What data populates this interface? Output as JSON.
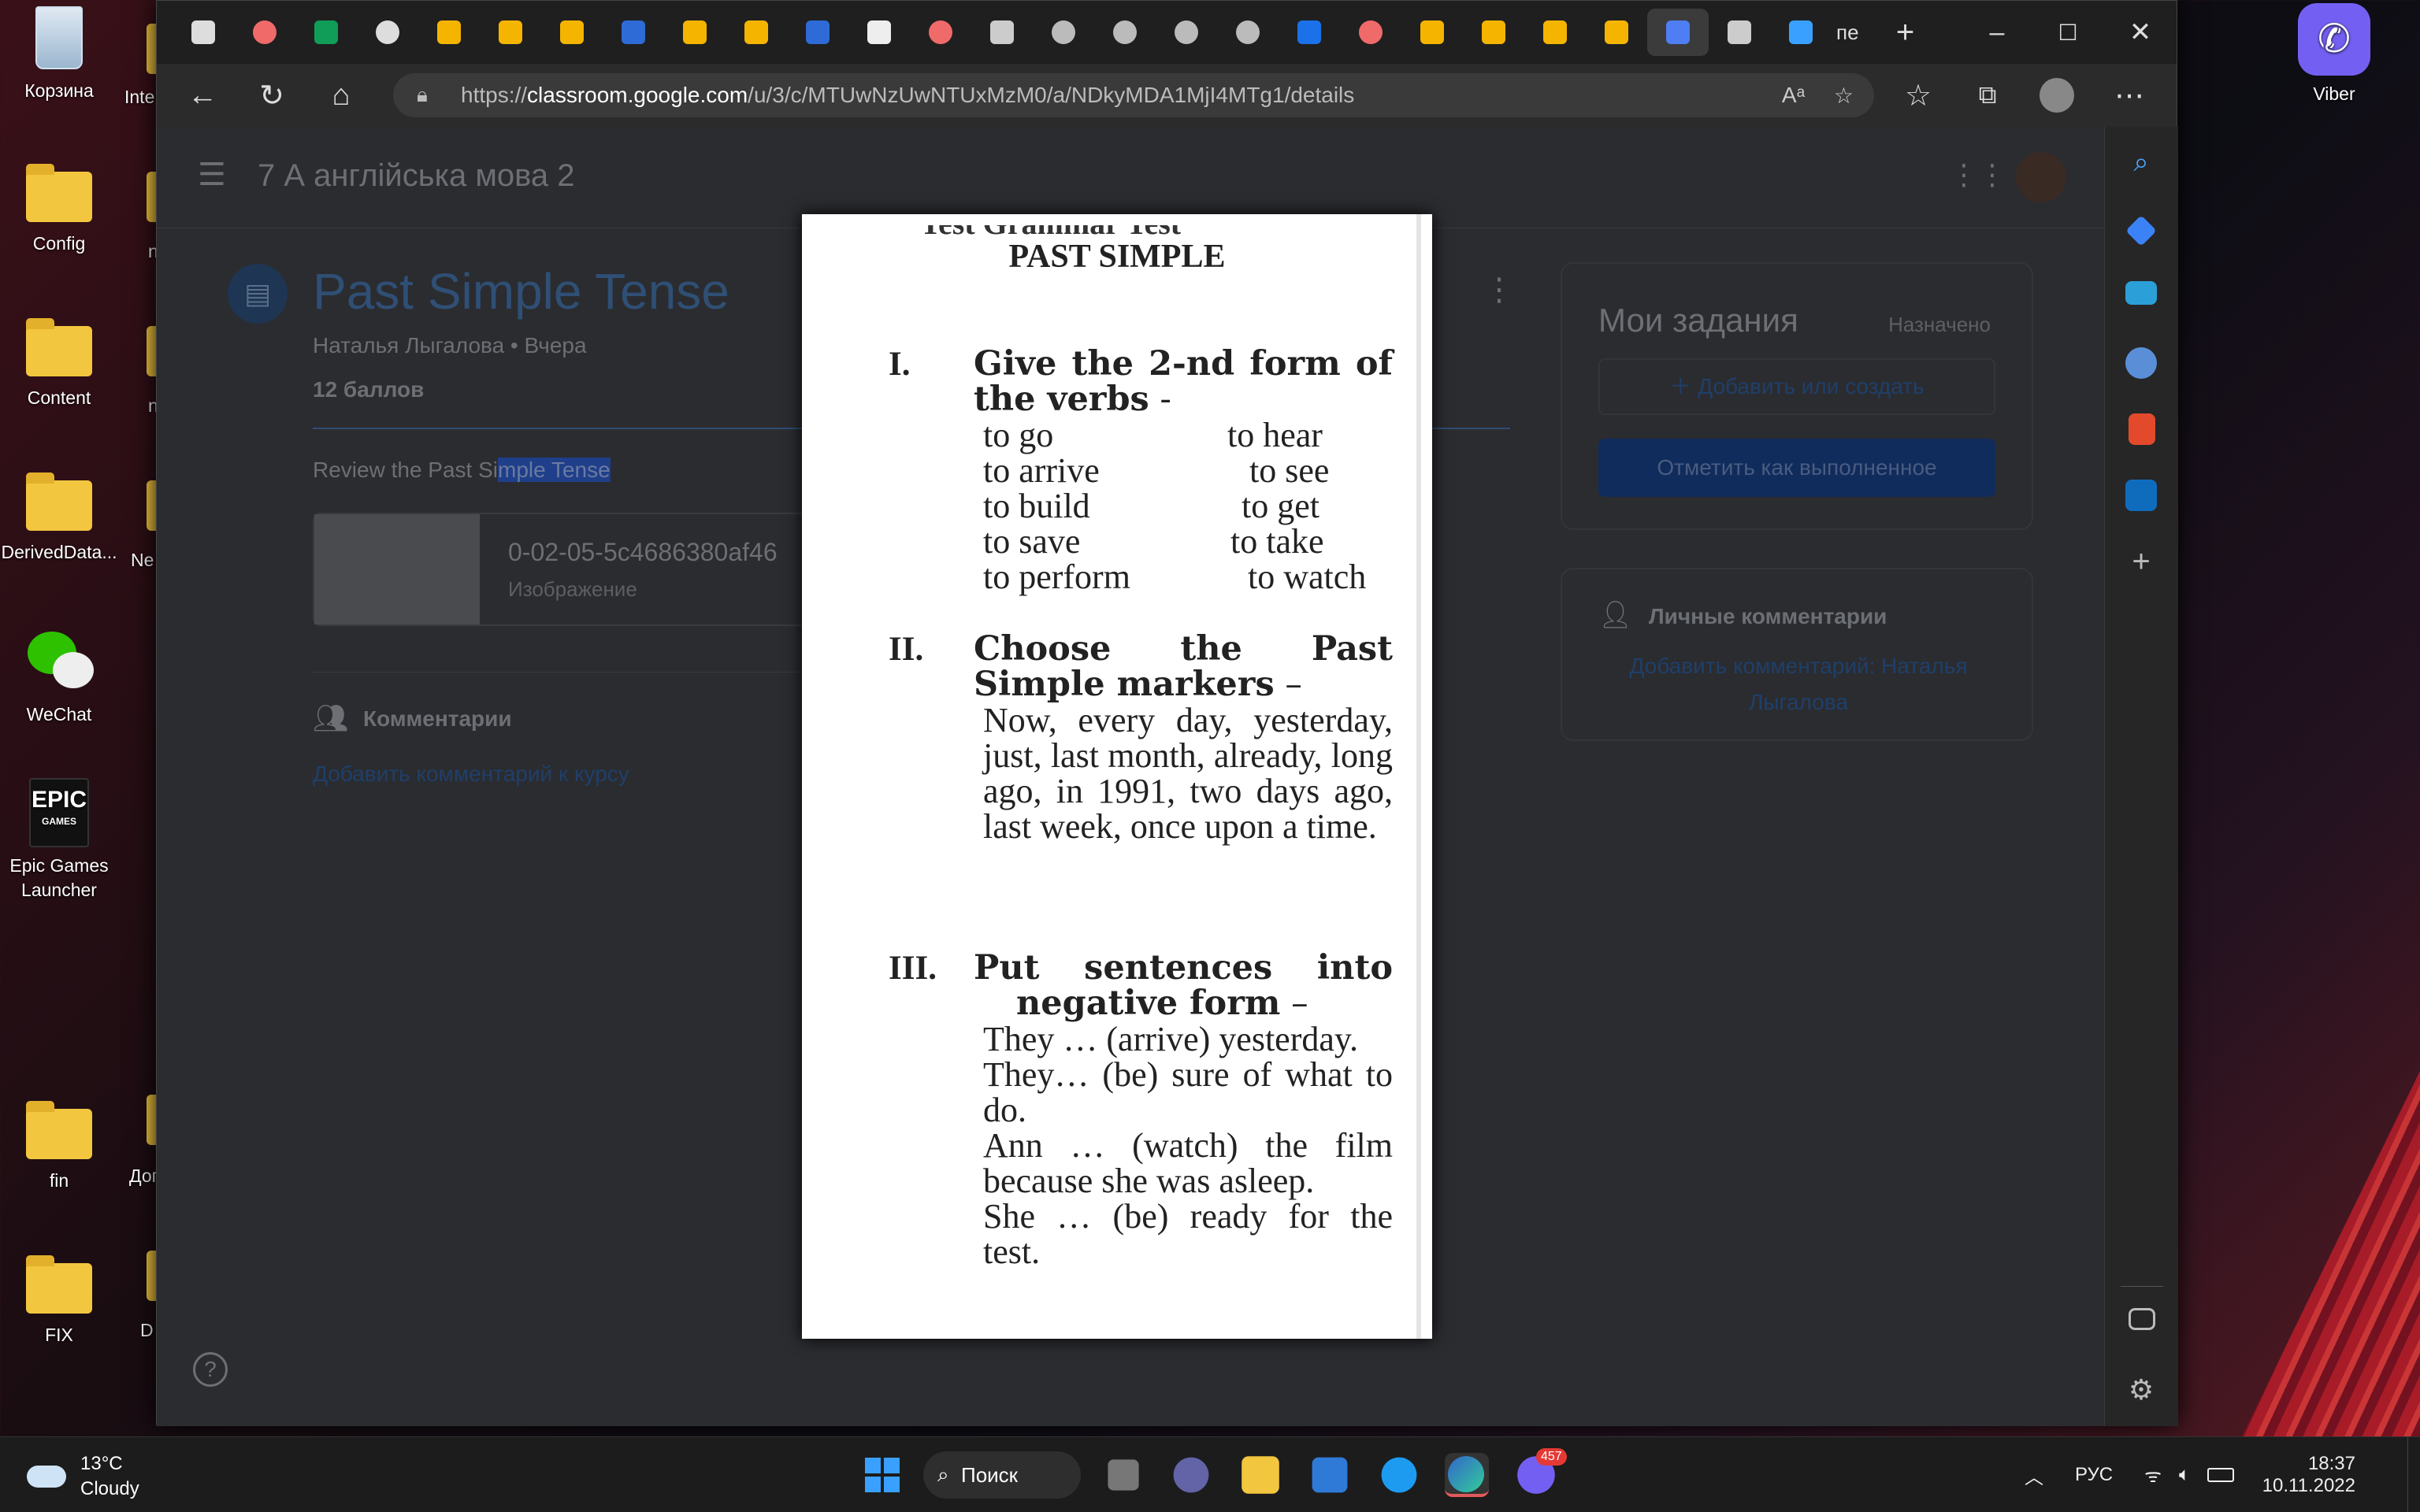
{
  "desktop": {
    "left_icons": [
      {
        "label": "Корзина",
        "icon": "recycle-bin-icon"
      },
      {
        "label": "Config",
        "icon": "folder-icon"
      },
      {
        "label": "Content",
        "icon": "folder-icon"
      },
      {
        "label": "DerivedData...",
        "icon": "folder-icon"
      },
      {
        "label": "WeChat",
        "icon": "wechat-icon"
      },
      {
        "label": "Epic Games Launcher",
        "icon": "epic-games-icon"
      },
      {
        "label": "fin",
        "icon": "folder-icon"
      },
      {
        "label": "FIX",
        "icon": "folder-icon"
      }
    ],
    "partial_labels": [
      "Inte",
      "n",
      "n",
      "Ne",
      "Дог",
      "D"
    ],
    "viber_label": "Viber"
  },
  "browser": {
    "url_prefix": "https://",
    "url_host": "classroom.google.com",
    "url_path": "/u/3/c/MTUwNzUwNTUxMzM0/a/NDkyMDA1MjI4MTg1/details",
    "last_tab_label": "пе",
    "tab_icons": [
      "tab-actions",
      "asana",
      "sheets",
      "chrome",
      "drive",
      "drive",
      "drive",
      "3d",
      "slides",
      "drive",
      "3d",
      "notion",
      "asana",
      "copilot",
      "unity",
      "unreal",
      "unreal",
      "unreal",
      "affinity",
      "asana",
      "drive",
      "drive",
      "drive",
      "slides",
      "classroom",
      "gift",
      "search"
    ]
  },
  "classroom": {
    "course_title": "7 А англійська мова 2",
    "assignment_title": "Past Simple Tense",
    "author_meta": "Наталья Лыгалова • Вчера",
    "points": "12 баллов",
    "instructions_plain": "Review the Past Si",
    "instructions_selected": "mple Tense",
    "attachment_name": "0-02-05-5c4686380af46",
    "attachment_type": "Изображение",
    "comments_heading": "Комментарии",
    "add_class_comment": "Добавить комментарий к курсу",
    "my_work_title": "Мои задания",
    "my_work_status": "Назначено",
    "add_or_create": "Добавить или создать",
    "mark_done": "Отметить как выполненное",
    "private_comments_heading": "Личные комментарии",
    "add_private_comment": "Добавить комментарий: Наталья Лыгалова"
  },
  "worksheet": {
    "cut_title": "Test Grammar Test",
    "title": "PAST SIMPLE",
    "sections": [
      {
        "numeral": "I.",
        "heading": "Give the 2-nd form of the verbs",
        "heading_suffix": " -",
        "verb_pairs": [
          [
            "to go",
            "to hear"
          ],
          [
            "to arrive",
            "to see"
          ],
          [
            "to build",
            "to get"
          ],
          [
            "to save",
            "to take"
          ],
          [
            "to perform",
            "to watch"
          ]
        ]
      },
      {
        "numeral": "II.",
        "heading": "Choose the Past Simple markers",
        "heading_suffix": " –",
        "body": "Now, every day, yesterday, just, last month, already, long ago, in 1991, two days ago, last week, once upon a time."
      },
      {
        "numeral": "III.",
        "heading": "Put sentences into negative form",
        "heading_suffix": " –",
        "lines": [
          "They … (arrive) yesterday.",
          "They… (be) sure of what to do.",
          "Ann … (watch) the film because she was asleep.",
          "She … (be) ready for the test."
        ]
      }
    ]
  },
  "taskbar": {
    "weather_temp": "13°C",
    "weather_desc": "Cloudy",
    "search_label": "Поиск",
    "language": "РУС",
    "time": "18:37",
    "date": "10.11.2022",
    "viber_badge": "457"
  },
  "colors": {
    "accent_blue": "#1a73e8",
    "dark_button": "#174ea6",
    "classroom_bg": "#2b2c30"
  }
}
